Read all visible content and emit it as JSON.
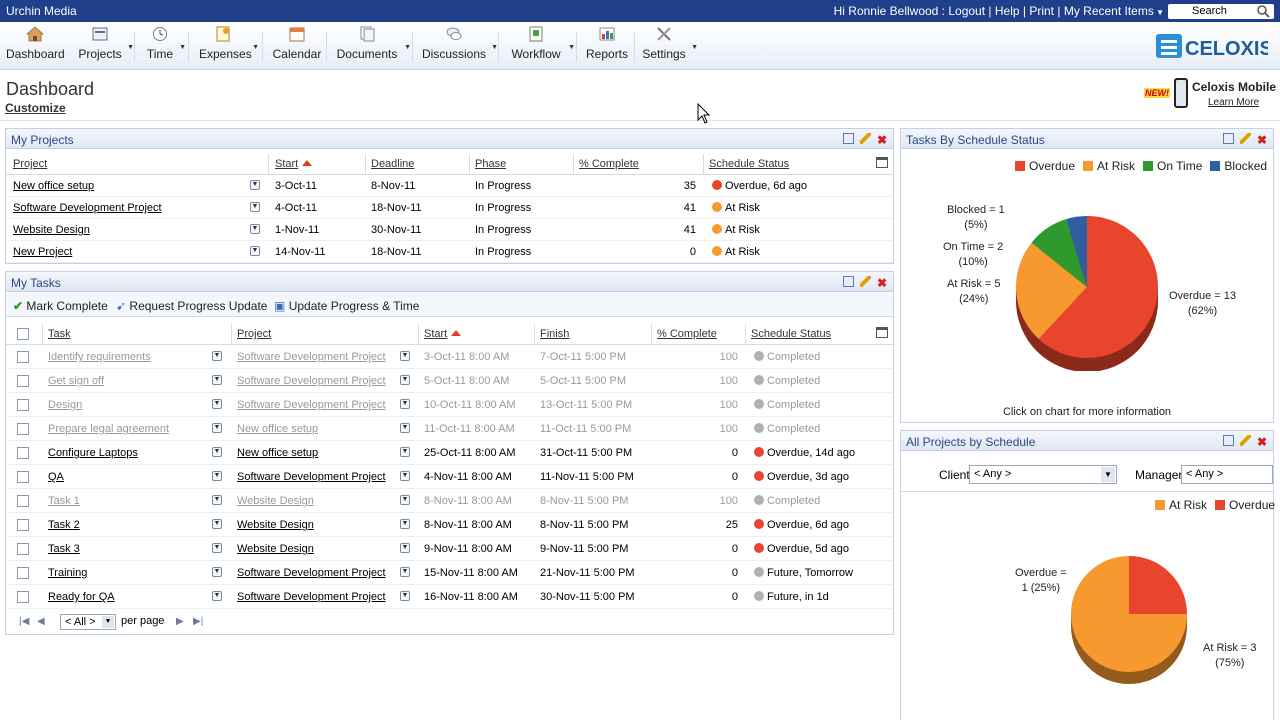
{
  "app": {
    "org_name": "Urchin Media",
    "greeting": "Hi Ronnie Bellwood : Logout",
    "links": [
      "Help",
      "Print",
      "My Recent Items"
    ],
    "search_label": "Search",
    "brand": "CELOXIS"
  },
  "nav": [
    {
      "label": "Dashboard",
      "icon": "house-icon"
    },
    {
      "label": "Projects",
      "icon": "projects-icon"
    },
    {
      "label": "Time",
      "icon": "clock-icon"
    },
    {
      "label": "Expenses",
      "icon": "expenses-icon"
    },
    {
      "label": "Calendar",
      "icon": "calendar-icon"
    },
    {
      "label": "Documents",
      "icon": "documents-icon"
    },
    {
      "label": "Discussions",
      "icon": "discussions-icon"
    },
    {
      "label": "Workflow",
      "icon": "workflow-icon"
    },
    {
      "label": "Reports",
      "icon": "reports-icon"
    },
    {
      "label": "Settings",
      "icon": "settings-icon"
    }
  ],
  "header": {
    "title": "Dashboard",
    "customize": "Customize",
    "mobile_new": "NEW!",
    "mobile_title": "Celoxis Mobile",
    "mobile_link": "Learn More"
  },
  "colors": {
    "overdue": "#e8452c",
    "at_risk": "#f7992f",
    "on_time": "#2e9a2e",
    "blocked": "#2f5fa0",
    "completed": "#b0b0b0",
    "future": "#b0b0b0"
  },
  "my_projects": {
    "title": "My Projects",
    "columns": [
      "Project",
      "Start",
      "Deadline",
      "Phase",
      "% Complete",
      "Schedule Status"
    ],
    "rows": [
      {
        "project": "New office setup",
        "start": "3-Oct-11",
        "deadline": "8-Nov-11",
        "phase": "In Progress",
        "complete": "35",
        "status": "Overdue, 6d ago",
        "status_color": "#e8452c"
      },
      {
        "project": "Software Development Project",
        "start": "4-Oct-11",
        "deadline": "18-Nov-11",
        "phase": "In Progress",
        "complete": "41",
        "status": "At Risk",
        "status_color": "#f7992f"
      },
      {
        "project": "Website Design",
        "start": "1-Nov-11",
        "deadline": "30-Nov-11",
        "phase": "In Progress",
        "complete": "41",
        "status": "At Risk",
        "status_color": "#f7992f"
      },
      {
        "project": "New Project",
        "start": "14-Nov-11",
        "deadline": "18-Nov-11",
        "phase": "In Progress",
        "complete": "0",
        "status": "At Risk",
        "status_color": "#f7992f"
      }
    ]
  },
  "my_tasks": {
    "title": "My Tasks",
    "actions": [
      "Mark Complete",
      "Request Progress Update",
      "Update Progress & Time"
    ],
    "columns": [
      "Task",
      "Project",
      "Start",
      "Finish",
      "% Complete",
      "Schedule Status"
    ],
    "rows": [
      {
        "task": "Identify requirements",
        "project": "Software Development Project",
        "start": "3-Oct-11 8:00 AM",
        "finish": "7-Oct-11 5:00 PM",
        "complete": "100",
        "status": "Completed",
        "status_color": "#b0b0b0",
        "muted": true
      },
      {
        "task": "Get sign off",
        "project": "Software Development Project",
        "start": "5-Oct-11 8:00 AM",
        "finish": "5-Oct-11 5:00 PM",
        "complete": "100",
        "status": "Completed",
        "status_color": "#b0b0b0",
        "muted": true
      },
      {
        "task": "Design",
        "project": "Software Development Project",
        "start": "10-Oct-11 8:00 AM",
        "finish": "13-Oct-11 5:00 PM",
        "complete": "100",
        "status": "Completed",
        "status_color": "#b0b0b0",
        "muted": true
      },
      {
        "task": "Prepare legal agreement",
        "project": "New office setup",
        "start": "11-Oct-11 8:00 AM",
        "finish": "11-Oct-11 5:00 PM",
        "complete": "100",
        "status": "Completed",
        "status_color": "#b0b0b0",
        "muted": true
      },
      {
        "task": "Configure Laptops",
        "project": "New office setup",
        "start": "25-Oct-11 8:00 AM",
        "finish": "31-Oct-11 5:00 PM",
        "complete": "0",
        "status": "Overdue, 14d ago",
        "status_color": "#e8452c",
        "muted": false
      },
      {
        "task": "QA",
        "project": "Software Development Project",
        "start": "4-Nov-11 8:00 AM",
        "finish": "11-Nov-11 5:00 PM",
        "complete": "0",
        "status": "Overdue, 3d ago",
        "status_color": "#e8452c",
        "muted": false
      },
      {
        "task": "Task 1",
        "project": "Website Design",
        "start": "8-Nov-11 8:00 AM",
        "finish": "8-Nov-11 5:00 PM",
        "complete": "100",
        "status": "Completed",
        "status_color": "#b0b0b0",
        "muted": true
      },
      {
        "task": "Task 2",
        "project": "Website Design",
        "start": "8-Nov-11 8:00 AM",
        "finish": "8-Nov-11 5:00 PM",
        "complete": "25",
        "status": "Overdue, 6d ago",
        "status_color": "#e8452c",
        "muted": false
      },
      {
        "task": "Task 3",
        "project": "Website Design",
        "start": "9-Nov-11 8:00 AM",
        "finish": "9-Nov-11 5:00 PM",
        "complete": "0",
        "status": "Overdue, 5d ago",
        "status_color": "#e8452c",
        "muted": false
      },
      {
        "task": "Training",
        "project": "Software Development Project",
        "start": "15-Nov-11 8:00 AM",
        "finish": "21-Nov-11 5:00 PM",
        "complete": "0",
        "status": "Future, Tomorrow",
        "status_color": "#b0b0b0",
        "muted": false
      },
      {
        "task": "Ready for QA",
        "project": "Software Development Project",
        "start": "16-Nov-11 8:00 AM",
        "finish": "30-Nov-11 5:00 PM",
        "complete": "0",
        "status": "Future, in 1d",
        "status_color": "#b0b0b0",
        "muted": false
      }
    ],
    "pager": {
      "value": "< All >",
      "suffix": "per page"
    }
  },
  "tasks_by_status": {
    "title": "Tasks By Schedule Status",
    "footer": "Click on chart for more information"
  },
  "all_projects": {
    "title": "All Projects by Schedule",
    "client_label": "Client",
    "client_value": "< Any >",
    "manager_label": "Manager",
    "manager_value": "< Any >"
  },
  "chart_data": [
    {
      "type": "pie",
      "title": "Tasks By Schedule Status",
      "legend": [
        "Overdue",
        "At Risk",
        "On Time",
        "Blocked"
      ],
      "slices": [
        {
          "label": "Overdue",
          "value": 13,
          "percent": 62,
          "color": "#e8452c",
          "text1": "Overdue = 13",
          "text2": "(62%)"
        },
        {
          "label": "At Risk",
          "value": 5,
          "percent": 24,
          "color": "#f7992f",
          "text1": "At Risk = 5",
          "text2": "(24%)"
        },
        {
          "label": "On Time",
          "value": 2,
          "percent": 10,
          "color": "#2e9a2e",
          "text1": "On Time = 2",
          "text2": "(10%)"
        },
        {
          "label": "Blocked",
          "value": 1,
          "percent": 5,
          "color": "#2f5fa0",
          "text1": "Blocked = 1",
          "text2": "(5%)"
        }
      ],
      "legend_position": "top-right"
    },
    {
      "type": "pie",
      "title": "All Projects by Schedule",
      "legend": [
        "At Risk",
        "Overdue"
      ],
      "slices": [
        {
          "label": "At Risk",
          "value": 3,
          "percent": 75,
          "color": "#f7992f",
          "text1": "At Risk = 3",
          "text2": "(75%)"
        },
        {
          "label": "Overdue",
          "value": 1,
          "percent": 25,
          "color": "#e8452c",
          "text1": "Overdue =",
          "text2": "1 (25%)"
        }
      ],
      "legend_position": "top-right"
    }
  ]
}
